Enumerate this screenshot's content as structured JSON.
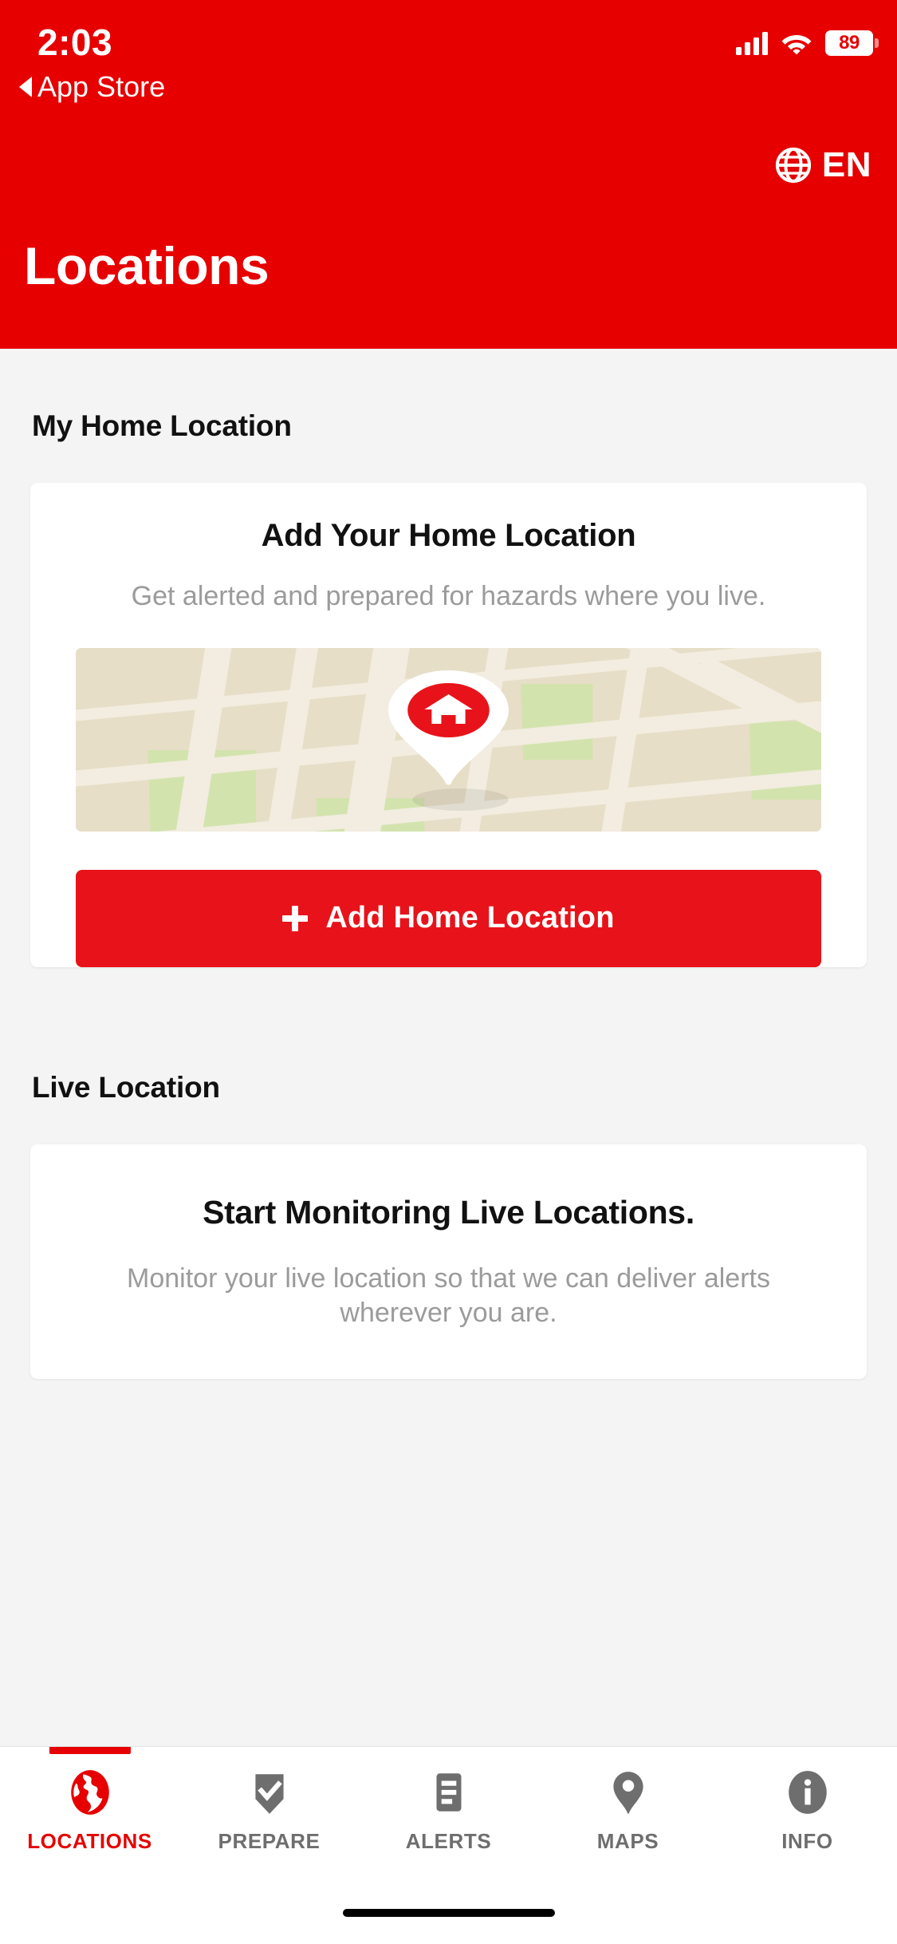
{
  "status_bar": {
    "time": "2:03",
    "back_label": "App Store",
    "battery_percent": "89",
    "signal_icon": "cellular-signal-icon",
    "wifi_icon": "wifi-icon",
    "battery_icon": "battery-icon"
  },
  "header": {
    "title": "Locations",
    "language_label": "EN",
    "language_icon": "globe-icon",
    "background_color": "#E60000"
  },
  "sections": {
    "home": {
      "heading": "My Home Location",
      "card": {
        "title": "Add Your Home Location",
        "description": "Get alerted and prepared for hazards where you live.",
        "map_icon": "home-map-pin-icon",
        "button_label": "Add Home Location",
        "button_icon": "plus-icon",
        "button_color": "#E8131A"
      }
    },
    "live": {
      "heading": "Live Location",
      "card": {
        "title": "Start Monitoring Live Locations.",
        "description": "Monitor your live location so that we can deliver alerts wherever you are."
      }
    }
  },
  "tabbar": {
    "items": [
      {
        "label": "LOCATIONS",
        "icon": "globe-locations-icon",
        "active": true
      },
      {
        "label": "PREPARE",
        "icon": "shield-check-icon",
        "active": false
      },
      {
        "label": "ALERTS",
        "icon": "document-lines-icon",
        "active": false
      },
      {
        "label": "MAPS",
        "icon": "map-pin-icon",
        "active": false
      },
      {
        "label": "INFO",
        "icon": "info-circle-icon",
        "active": false
      }
    ],
    "active_color": "#E60000",
    "inactive_color": "#6E6E6E"
  }
}
